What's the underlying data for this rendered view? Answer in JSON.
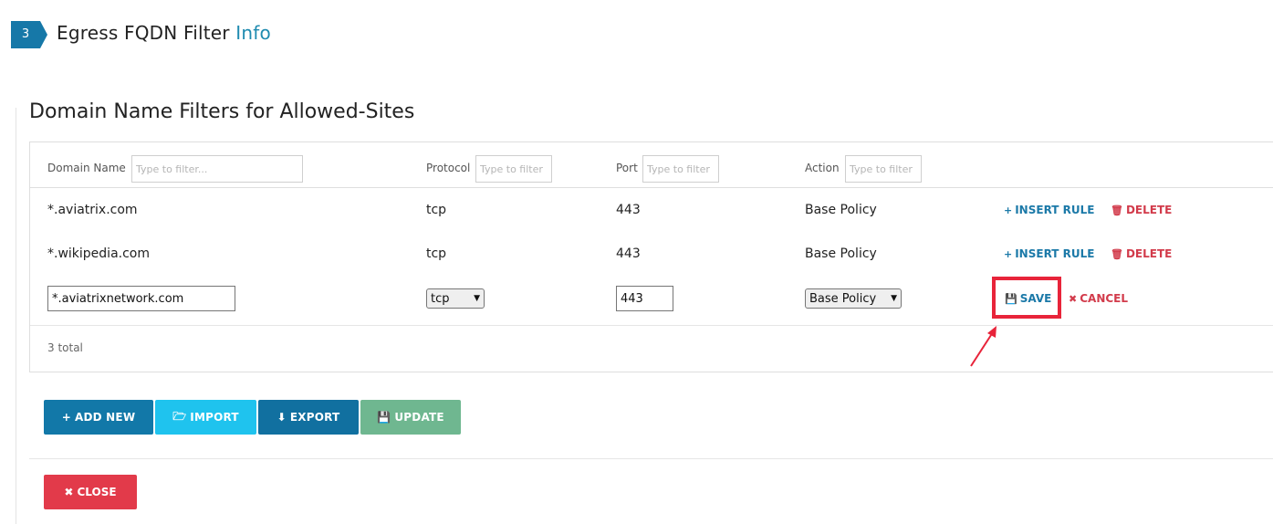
{
  "step": {
    "number": "3",
    "title": "Egress FQDN Filter",
    "info_link": "Info"
  },
  "panel": {
    "title": "Domain Name Filters for Allowed-Sites"
  },
  "table": {
    "columns": [
      {
        "label": "Domain Name",
        "filter_placeholder": "Type to filter..."
      },
      {
        "label": "Protocol",
        "filter_placeholder": "Type to filter"
      },
      {
        "label": "Port",
        "filter_placeholder": "Type to filter"
      },
      {
        "label": "Action",
        "filter_placeholder": "Type to filter"
      }
    ],
    "rows": [
      {
        "domain": "*.aviatrix.com",
        "protocol": "tcp",
        "port": "443",
        "action": "Base Policy",
        "insert_label": "INSERT RULE",
        "delete_label": "DELETE"
      },
      {
        "domain": "*.wikipedia.com",
        "protocol": "tcp",
        "port": "443",
        "action": "Base Policy",
        "insert_label": "INSERT RULE",
        "delete_label": "DELETE"
      }
    ],
    "edit_row": {
      "domain": "*.aviatrixnetwork.com",
      "protocol": "tcp",
      "port": "443",
      "action": "Base Policy",
      "save_label": "SAVE",
      "cancel_label": "CANCEL"
    },
    "total": "3 total"
  },
  "buttons": {
    "add_new": "ADD NEW",
    "import": "IMPORT",
    "export": "EXPORT",
    "update": "UPDATE",
    "close": "CLOSE"
  },
  "icons": {
    "plus": "plus-icon",
    "trash": "trash-icon",
    "save": "floppy-icon",
    "cancel": "x-icon",
    "folder": "folder-open-icon",
    "download": "download-icon"
  },
  "colors": {
    "primary": "#1278a8",
    "info_link": "#1f8bb0",
    "danger": "#e23a4a",
    "import": "#1fc3ee",
    "update": "#6fb790",
    "highlight": "#e8243a"
  }
}
